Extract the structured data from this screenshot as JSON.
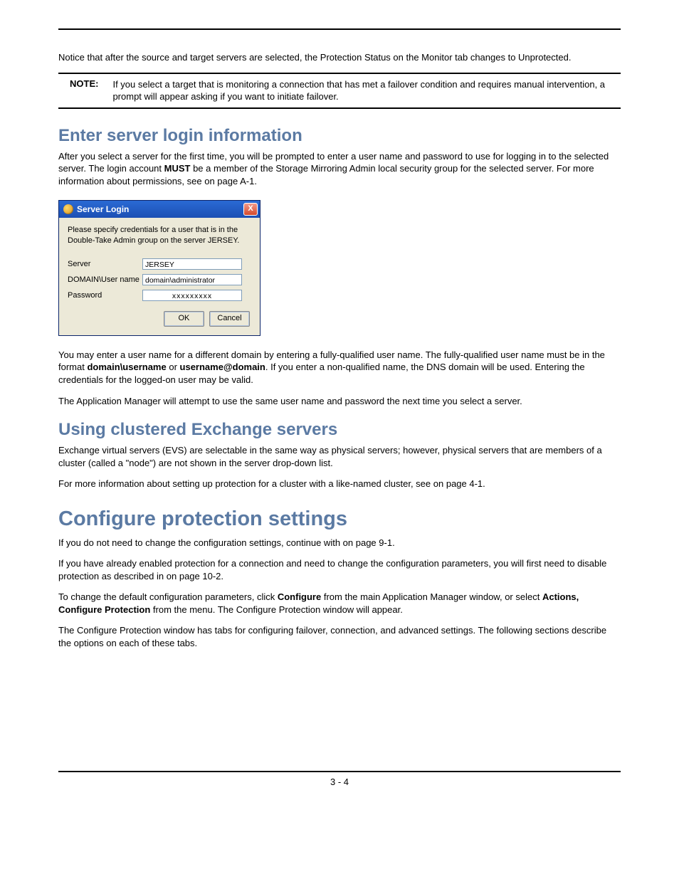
{
  "intro_text": "Notice that after the source and target servers are selected, the Protection Status on the Monitor tab changes to Unprotected.",
  "note": {
    "label": "NOTE:",
    "text": "If you select a target that is monitoring a connection that has met a failover condition and requires manual intervention, a prompt will appear asking if you want to initiate failover."
  },
  "section1": {
    "heading": "Enter server login information",
    "para1_a": "After you select a server for the first time, you will be prompted to enter a user name and password to use for logging in to the selected server. The login account ",
    "para1_bold": "MUST",
    "para1_b": " be a member of the Storage Mirroring Admin local security group for the selected server. For more information about permissions, see ",
    "para1_c": " on page A-1."
  },
  "dialog": {
    "title": "Server Login",
    "close": "X",
    "instruct": "Please specify credentials for a user that is in the Double-Take Admin group on the server JERSEY.",
    "server_label": "Server",
    "server_value": "JERSEY",
    "user_label": "DOMAIN\\User name",
    "user_value": "domain\\administrator",
    "pass_label": "Password",
    "pass_value": "xxxxxxxxx",
    "ok": "OK",
    "cancel": "Cancel"
  },
  "after_dialog": {
    "para1_a": "You may enter a user name for a different domain by entering a fully-qualified user name. The fully-qualified user name must be in the format ",
    "para1_b1": "domain\\username",
    "para1_mid": " or ",
    "para1_b2": "username@domain",
    "para1_c": ". If you enter a non-qualified name, the DNS domain will be used. Entering the credentials for the logged-on user may be valid.",
    "para2": "The Application Manager will attempt to use the same user name and password the next time you select a server."
  },
  "section2": {
    "heading": "Using clustered Exchange servers",
    "para1": "Exchange virtual servers (EVS) are selectable in the same way as physical servers; however, physical servers that are members of a cluster (called a \"node\") are not shown in the server drop-down list.",
    "para2_a": "For more information about setting up protection for a cluster with a like-named cluster, see ",
    "para2_b": " on page 4-1."
  },
  "section3": {
    "heading": "Configure protection settings",
    "para1_a": "If you do not need to change the configuration settings, continue with ",
    "para1_b": " on page 9-1.",
    "para2_a": "If you have already enabled protection for a connection and need to change the configuration parameters, you will first need to disable protection as described in ",
    "para2_b": " on page 10-2.",
    "para3_a": "To change the default configuration parameters, click ",
    "para3_b1": "Configure",
    "para3_mid": " from the main Application Manager window, or select ",
    "para3_b2": "Actions, Configure Protection",
    "para3_c": " from the menu. The Configure Protection window will appear.",
    "para4": "The Configure Protection window has tabs for configuring failover, connection, and advanced settings. The following sections describe the options on each of these tabs."
  },
  "page_number": "3 - 4"
}
